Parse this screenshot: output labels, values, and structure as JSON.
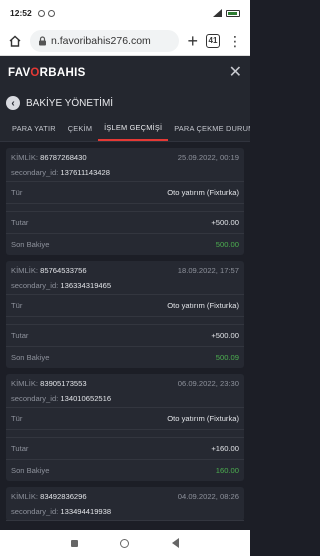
{
  "status": {
    "time": "12:52",
    "battery": "86"
  },
  "browser": {
    "url": "n.favoribahis276.com",
    "tab_count": "41"
  },
  "site": {
    "logo_prefix": "FAV",
    "logo_o": "O",
    "logo_suffix": "RBAHIS"
  },
  "page": {
    "title": "BAKİYE YÖNETİMİ"
  },
  "tabs": [
    {
      "label": "PARA YATIR"
    },
    {
      "label": "ÇEKİM"
    },
    {
      "label": "İŞLEM GEÇMİŞİ"
    },
    {
      "label": "PARA ÇEKME DURUMU"
    }
  ],
  "transactions": [
    {
      "kimlik_label": "KİMLİK:",
      "kimlik": "86787268430",
      "date": "25.09.2022, 00:19",
      "secondary_label": "secondary_id:",
      "secondary": "137611143428",
      "tur_label": "Tür",
      "tur": "Oto yatırım (Fixturka)",
      "tutar_label": "Tutar",
      "tutar": "+500.00",
      "bakiye_label": "Son Bakiye",
      "bakiye": "500.00"
    },
    {
      "kimlik_label": "KİMLİK:",
      "kimlik": "85764533756",
      "date": "18.09.2022, 17:57",
      "secondary_label": "secondary_id:",
      "secondary": "136334319465",
      "tur_label": "Tür",
      "tur": "Oto yatırım (Fixturka)",
      "tutar_label": "Tutar",
      "tutar": "+500.00",
      "bakiye_label": "Son Bakiye",
      "bakiye": "500.09"
    },
    {
      "kimlik_label": "KİMLİK:",
      "kimlik": "83905173553",
      "date": "06.09.2022, 23:30",
      "secondary_label": "secondary_id:",
      "secondary": "134010652516",
      "tur_label": "Tür",
      "tur": "Oto yatırım (Fixturka)",
      "tutar_label": "Tutar",
      "tutar": "+160.00",
      "bakiye_label": "Son Bakiye",
      "bakiye": "160.00"
    },
    {
      "kimlik_label": "KİMLİK:",
      "kimlik": "83492836296",
      "date": "04.09.2022, 08:26",
      "secondary_label": "secondary_id:",
      "secondary": "133494419938"
    }
  ]
}
